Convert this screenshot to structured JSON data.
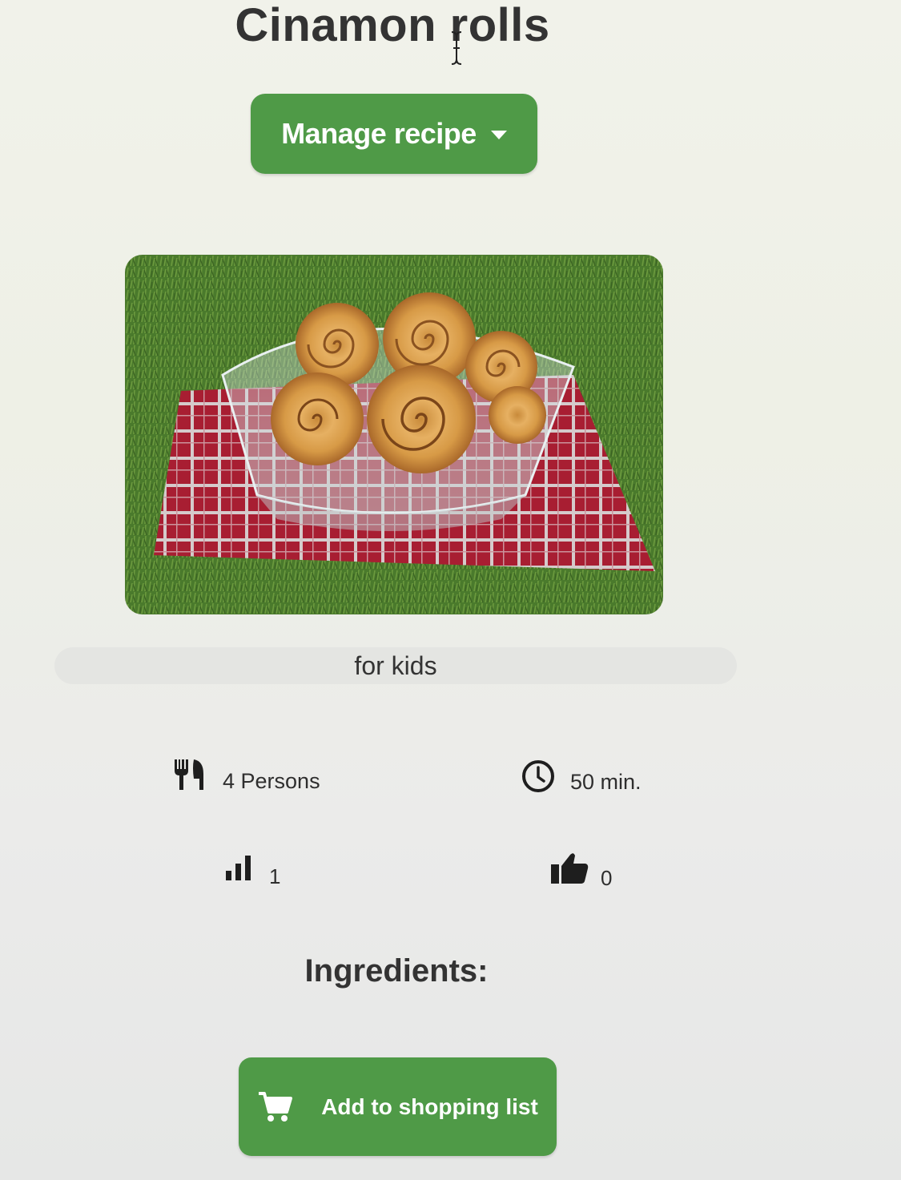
{
  "recipe": {
    "title": "Cinamon rolls",
    "manage_label": "Manage recipe",
    "tag": "for kids",
    "persons": "4 Persons",
    "time": "50 min.",
    "level": "1",
    "likes": "0",
    "ingredients_heading": "Ingredients:",
    "shopping_label": "Add to shopping list"
  },
  "icons": {
    "servings": "utensils-icon",
    "time": "clock-icon",
    "difficulty": "signal-bars-icon",
    "likes": "thumbs-up-icon",
    "cart": "shopping-cart-icon",
    "manage_caret": "caret-down-icon"
  },
  "colors": {
    "accent": "#4f9a47",
    "tag_background": "#e4e5e2"
  }
}
